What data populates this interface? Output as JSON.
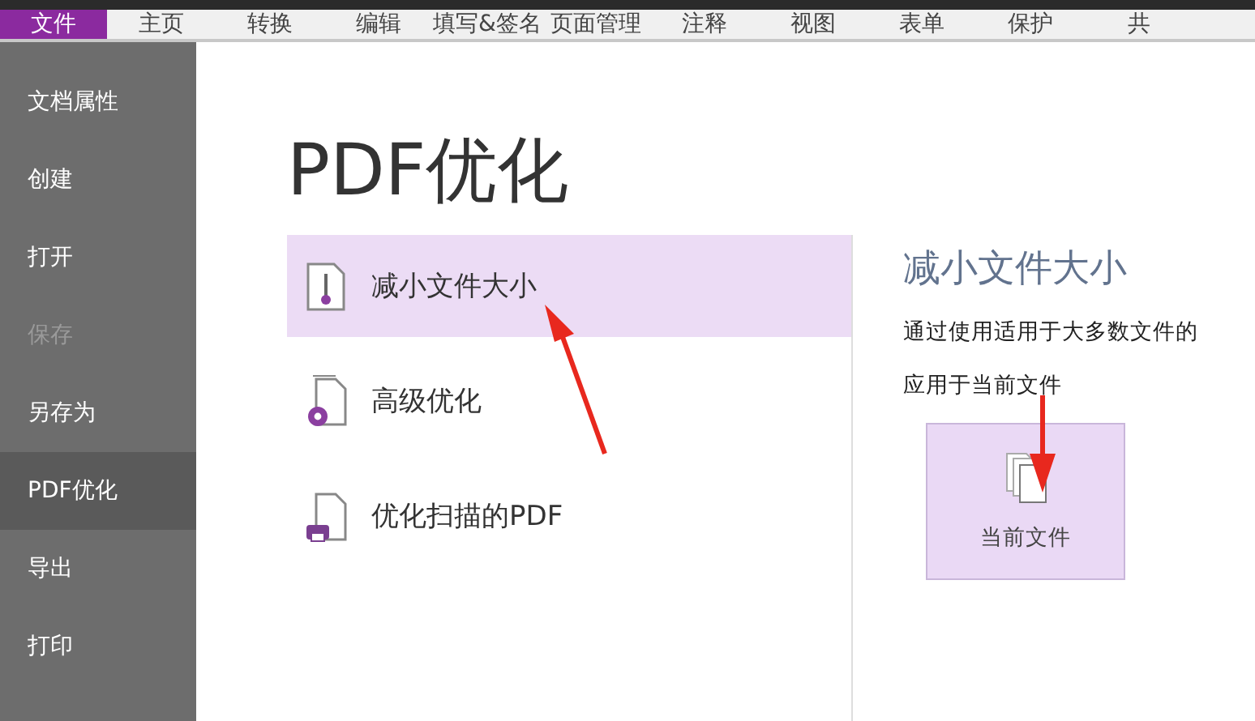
{
  "menu_bar": {
    "items": [
      {
        "label": "文件",
        "selected": true
      },
      {
        "label": "主页",
        "selected": false
      },
      {
        "label": "转换",
        "selected": false
      },
      {
        "label": "编辑",
        "selected": false
      },
      {
        "label": "填写&签名",
        "selected": false
      },
      {
        "label": "页面管理",
        "selected": false
      },
      {
        "label": "注释",
        "selected": false
      },
      {
        "label": "视图",
        "selected": false
      },
      {
        "label": "表单",
        "selected": false
      },
      {
        "label": "保护",
        "selected": false
      },
      {
        "label": "共",
        "selected": false
      }
    ]
  },
  "sidebar": {
    "items": [
      {
        "label": "文档属性",
        "selected": false,
        "disabled": false
      },
      {
        "label": "创建",
        "selected": false,
        "disabled": false
      },
      {
        "label": "打开",
        "selected": false,
        "disabled": false
      },
      {
        "label": "保存",
        "selected": false,
        "disabled": true
      },
      {
        "label": "另存为",
        "selected": false,
        "disabled": false
      },
      {
        "label": "PDF优化",
        "selected": true,
        "disabled": false
      },
      {
        "label": "导出",
        "selected": false,
        "disabled": false
      },
      {
        "label": "打印",
        "selected": false,
        "disabled": false
      }
    ]
  },
  "page_title": "PDF优化",
  "options": [
    {
      "label": "减小文件大小",
      "kind": "reduce",
      "selected": true
    },
    {
      "label": "高级优化",
      "kind": "advanced",
      "selected": false
    },
    {
      "label": "优化扫描的PDF",
      "kind": "scan",
      "selected": false
    }
  ],
  "detail": {
    "title": "减小文件大小",
    "description": "通过使用适用于大多数文件的",
    "apply_label": "应用于当前文件",
    "button": "当前文件"
  }
}
